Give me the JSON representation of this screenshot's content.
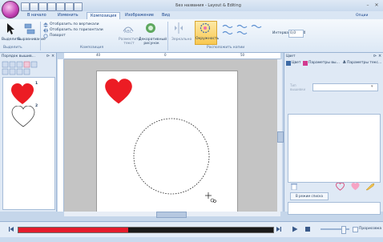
{
  "window": {
    "title": "Без названия - Layout & Editing",
    "options_label": "Опции"
  },
  "tabs": [
    {
      "label": "В начало"
    },
    {
      "label": "Изменить"
    },
    {
      "label": "Композиция"
    },
    {
      "label": "Изображение"
    },
    {
      "label": "Вид"
    }
  ],
  "ribbon": {
    "select_label": "Выделить",
    "align_label": "Выравнивание",
    "flip_vertical": "Отобразить по вертикали",
    "flip_horizontal": "Отобразить по горизонтали",
    "rotate_label": "Поворот",
    "text_layout_label": "Разместить текст",
    "decorative_pattern_label": "Декоративный рисунок",
    "mirrors_label": "Зеркально",
    "circle_label": "Окружность",
    "spacing_label": "Интервал",
    "spacing_value": "0,0",
    "groups": {
      "select": "Выделить",
      "composition": "Композиция",
      "arrange_copies": "Расположить копии"
    }
  },
  "left_panel": {
    "title": "Порядок вышив...",
    "items": [
      {
        "number": "1"
      },
      {
        "number": "2"
      }
    ]
  },
  "ruler": {
    "h_marks": [
      "40",
      "0",
      "50"
    ]
  },
  "right_panel": {
    "title": "Цвет",
    "tabs": [
      {
        "label": "Цвет"
      },
      {
        "label": "Параметры вы..."
      },
      {
        "label": "Параметры текс..."
      }
    ],
    "field_label": "Тип вышивки",
    "field_value": "",
    "list_button": "В режим списка"
  },
  "playback": {
    "preview_label": "Прорисовка",
    "progress": 0.43
  },
  "colors": {
    "heart_red": "#ec1c24",
    "progress_red": "#e41c2c",
    "accent_blue": "#3d6aa5"
  }
}
